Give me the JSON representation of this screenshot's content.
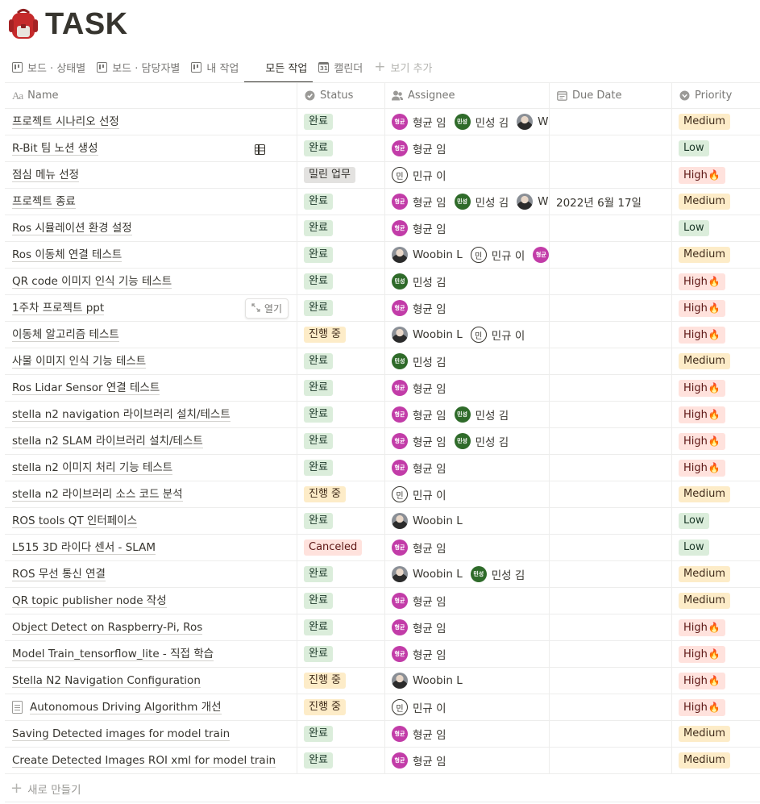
{
  "page": {
    "title": "TASK",
    "icon": "backpack-icon"
  },
  "views": [
    {
      "label": "보드 · 상태별",
      "icon": "board-icon",
      "active": false
    },
    {
      "label": "보드 · 담당자별",
      "icon": "board-icon",
      "active": false
    },
    {
      "label": "내 작업",
      "icon": "board-icon",
      "active": false
    },
    {
      "label": "모든 작업",
      "icon": "table-icon",
      "active": true
    },
    {
      "label": "캘린더",
      "icon": "calendar-icon",
      "active": false
    }
  ],
  "add_view_label": "보기 추가",
  "calendar_icon_text": "31",
  "columns": {
    "name": {
      "label": "Name",
      "icon_text": "Aa"
    },
    "status": {
      "label": "Status"
    },
    "assignee": {
      "label": "Assignee"
    },
    "due": {
      "label": "Due Date"
    },
    "priority": {
      "label": "Priority"
    }
  },
  "open_label": "열기",
  "new_row_label": "새로 만들기",
  "status_colors": {
    "완료": "#dbeddb",
    "밀린 업무": "#e3e2e0",
    "진행 중": "#fdecc8",
    "Canceled": "#ffe2dd"
  },
  "priority_colors": {
    "Medium": "#fdecc8",
    "Low": "#dbeddb",
    "High": "#ffe2dd"
  },
  "rows": [
    {
      "name": "프로젝트 시나리오 선정",
      "status": "완료",
      "assignees": [
        {
          "name": "형균 임",
          "avatar": "pink",
          "initials": "형균"
        },
        {
          "name": "민성 김",
          "avatar": "green",
          "initials": "민성"
        },
        {
          "name": "W",
          "avatar": "photo",
          "initials": ""
        }
      ],
      "due": "",
      "priority": "Medium",
      "fire": ""
    },
    {
      "name": "R-Bit 팀 노션 생성",
      "status": "완료",
      "assignees": [
        {
          "name": "형균 임",
          "avatar": "pink",
          "initials": "형균"
        }
      ],
      "due": "",
      "priority": "Low",
      "fire": ""
    },
    {
      "name": "점심 메뉴 선정",
      "status": "밀린 업무",
      "assignees": [
        {
          "name": "민규 이",
          "avatar": "outline",
          "initials": "민"
        }
      ],
      "due": "",
      "priority": "High",
      "fire": "🔥"
    },
    {
      "name": "프로젝트 종료",
      "status": "완료",
      "assignees": [
        {
          "name": "형균 임",
          "avatar": "pink",
          "initials": "형균"
        },
        {
          "name": "민성 김",
          "avatar": "green",
          "initials": "민성"
        },
        {
          "name": "W",
          "avatar": "photo",
          "initials": ""
        }
      ],
      "due": "2022년 6월 17일",
      "priority": "Medium",
      "fire": ""
    },
    {
      "name": "Ros 시뮬레이션 환경 설정",
      "status": "완료",
      "assignees": [
        {
          "name": "형균 임",
          "avatar": "pink",
          "initials": "형균"
        }
      ],
      "due": "",
      "priority": "Low",
      "fire": ""
    },
    {
      "name": "Ros 이동체 연결 테스트",
      "status": "완료",
      "assignees": [
        {
          "name": "Woobin L",
          "avatar": "photo",
          "initials": ""
        },
        {
          "name": "민규 이",
          "avatar": "outline",
          "initials": "민"
        },
        {
          "name": "",
          "avatar": "pink",
          "initials": "형균"
        }
      ],
      "due": "",
      "priority": "Medium",
      "fire": ""
    },
    {
      "name": "QR code 이미지 인식 기능 테스트",
      "status": "완료",
      "assignees": [
        {
          "name": "민성 김",
          "avatar": "green",
          "initials": "민성"
        }
      ],
      "due": "",
      "priority": "High",
      "fire": "🔥"
    },
    {
      "name": "1주차 프로젝트 ppt",
      "status": "완료",
      "assignees": [
        {
          "name": "형균 임",
          "avatar": "pink",
          "initials": "형균"
        }
      ],
      "due": "",
      "priority": "High",
      "fire": "🔥",
      "hover": true
    },
    {
      "name": "이동체 알고리즘 테스트",
      "status": "진행 중",
      "assignees": [
        {
          "name": "Woobin L",
          "avatar": "photo",
          "initials": ""
        },
        {
          "name": "민규 이",
          "avatar": "outline",
          "initials": "민"
        }
      ],
      "due": "",
      "priority": "High",
      "fire": "🔥"
    },
    {
      "name": "사물 이미지 인식 기능 테스트",
      "status": "완료",
      "assignees": [
        {
          "name": "민성 김",
          "avatar": "green",
          "initials": "민성"
        }
      ],
      "due": "",
      "priority": "Medium",
      "fire": ""
    },
    {
      "name": "Ros Lidar Sensor 연결 테스트",
      "status": "완료",
      "assignees": [
        {
          "name": "형균 임",
          "avatar": "pink",
          "initials": "형균"
        }
      ],
      "due": "",
      "priority": "High",
      "fire": "🔥"
    },
    {
      "name": "stella n2 navigation 라이브러리 설치/테스트",
      "status": "완료",
      "assignees": [
        {
          "name": "형균 임",
          "avatar": "pink",
          "initials": "형균"
        },
        {
          "name": "민성 김",
          "avatar": "green",
          "initials": "민성"
        }
      ],
      "due": "",
      "priority": "High",
      "fire": "🔥"
    },
    {
      "name": "stella n2 SLAM 라이브러리 설치/테스트",
      "status": "완료",
      "assignees": [
        {
          "name": "형균 임",
          "avatar": "pink",
          "initials": "형균"
        },
        {
          "name": "민성 김",
          "avatar": "green",
          "initials": "민성"
        }
      ],
      "due": "",
      "priority": "High",
      "fire": "🔥"
    },
    {
      "name": "stella n2 이미지 처리 기능 테스트",
      "status": "완료",
      "assignees": [
        {
          "name": "형균 임",
          "avatar": "pink",
          "initials": "형균"
        }
      ],
      "due": "",
      "priority": "High",
      "fire": "🔥"
    },
    {
      "name": "stella n2 라이브러리 소스 코드 분석",
      "status": "진행 중",
      "assignees": [
        {
          "name": "민규 이",
          "avatar": "outline",
          "initials": "민"
        }
      ],
      "due": "",
      "priority": "Medium",
      "fire": ""
    },
    {
      "name": "ROS tools QT 인터페이스",
      "status": "완료",
      "assignees": [
        {
          "name": "Woobin L",
          "avatar": "photo",
          "initials": ""
        }
      ],
      "due": "",
      "priority": "Low",
      "fire": ""
    },
    {
      "name": "L515 3D 라이다 센서 - SLAM",
      "status": "Canceled",
      "assignees": [
        {
          "name": "형균 임",
          "avatar": "pink",
          "initials": "형균"
        }
      ],
      "due": "",
      "priority": "Low",
      "fire": ""
    },
    {
      "name": "ROS 무선 통신 연결",
      "status": "완료",
      "assignees": [
        {
          "name": "Woobin L",
          "avatar": "photo",
          "initials": ""
        },
        {
          "name": "민성 김",
          "avatar": "green",
          "initials": "민성"
        }
      ],
      "due": "",
      "priority": "Medium",
      "fire": ""
    },
    {
      "name": "QR topic publisher node 작성",
      "status": "완료",
      "assignees": [
        {
          "name": "형균 임",
          "avatar": "pink",
          "initials": "형균"
        }
      ],
      "due": "",
      "priority": "Medium",
      "fire": ""
    },
    {
      "name": "Object Detect on Raspberry-Pi, Ros",
      "status": "완료",
      "assignees": [
        {
          "name": "형균 임",
          "avatar": "pink",
          "initials": "형균"
        }
      ],
      "due": "",
      "priority": "High",
      "fire": "🔥"
    },
    {
      "name": "Model Train_tensorflow_lite - 직접 학습",
      "status": "완료",
      "assignees": [
        {
          "name": "형균 임",
          "avatar": "pink",
          "initials": "형균"
        }
      ],
      "due": "",
      "priority": "High",
      "fire": "🔥"
    },
    {
      "name": "Stella N2 Navigation Configuration",
      "status": "진행 중",
      "assignees": [
        {
          "name": "Woobin L",
          "avatar": "photo",
          "initials": ""
        }
      ],
      "due": "",
      "priority": "High",
      "fire": "🔥"
    },
    {
      "name": "Autonomous Driving Algorithm 개선",
      "status": "진행 중",
      "assignees": [
        {
          "name": "민규 이",
          "avatar": "outline",
          "initials": "민"
        }
      ],
      "due": "",
      "priority": "High",
      "fire": "🔥",
      "doc_icon": true
    },
    {
      "name": "Saving Detected images for model train",
      "status": "완료",
      "assignees": [
        {
          "name": "형균 임",
          "avatar": "pink",
          "initials": "형균"
        }
      ],
      "due": "",
      "priority": "Medium",
      "fire": ""
    },
    {
      "name": "Create Detected Images ROI xml for model train",
      "status": "완료",
      "assignees": [
        {
          "name": "형균 임",
          "avatar": "pink",
          "initials": "형균"
        }
      ],
      "due": "",
      "priority": "Medium",
      "fire": ""
    }
  ]
}
